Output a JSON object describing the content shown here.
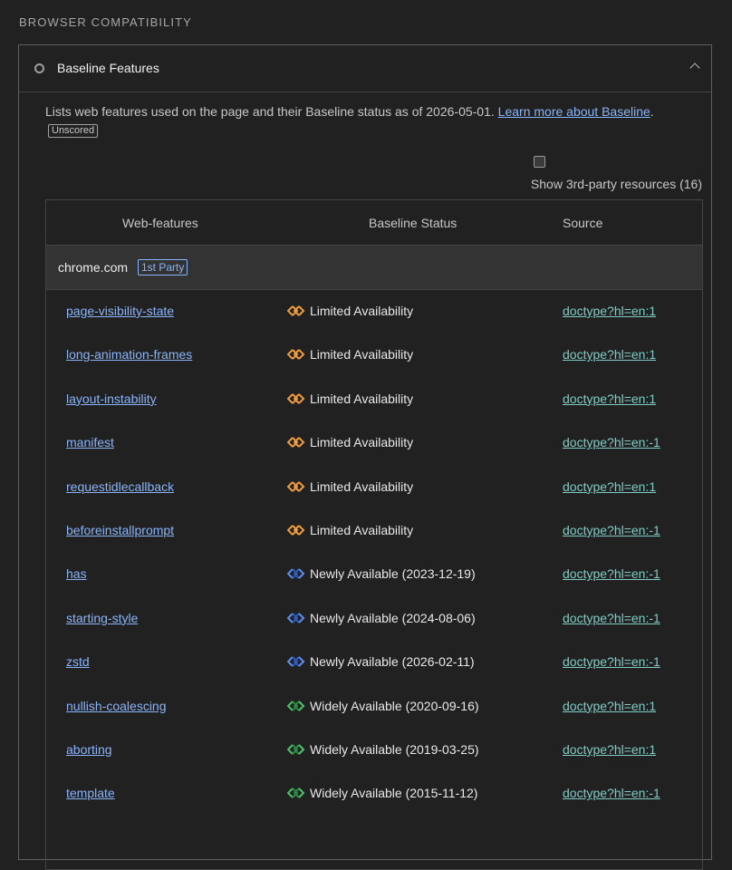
{
  "section_header": "BROWSER COMPATIBILITY",
  "card": {
    "title": "Baseline Features",
    "description": "Lists web features used on the page and their Baseline status as of 2026-05-01. ",
    "learn_more": "Learn more about Baseline",
    "description_end": ".",
    "badge": "Unscored"
  },
  "third_party": {
    "label": "Show 3rd-party resources (16)"
  },
  "table": {
    "headers": {
      "feature": "Web-features",
      "status": "Baseline Status",
      "source": "Source"
    },
    "group": {
      "name": "chrome.com",
      "badge": "1st Party"
    },
    "rows": [
      {
        "feature": "page-visibility-state",
        "status": "Limited Availability",
        "kind": "limited",
        "source": "doctype?hl=en:1"
      },
      {
        "feature": "long-animation-frames",
        "status": "Limited Availability",
        "kind": "limited",
        "source": "doctype?hl=en:1"
      },
      {
        "feature": "layout-instability",
        "status": "Limited Availability",
        "kind": "limited",
        "source": "doctype?hl=en:1"
      },
      {
        "feature": "manifest",
        "status": "Limited Availability",
        "kind": "limited",
        "source": "doctype?hl=en:-1"
      },
      {
        "feature": "requestidlecallback",
        "status": "Limited Availability",
        "kind": "limited",
        "source": "doctype?hl=en:1"
      },
      {
        "feature": "beforeinstallprompt",
        "status": "Limited Availability",
        "kind": "limited",
        "source": "doctype?hl=en:-1"
      },
      {
        "feature": "has",
        "status": "Newly Available (2023-12-19)",
        "kind": "newly",
        "source": "doctype?hl=en:-1"
      },
      {
        "feature": "starting-style",
        "status": "Newly Available (2024-08-06)",
        "kind": "newly",
        "source": "doctype?hl=en:-1"
      },
      {
        "feature": "zstd",
        "status": "Newly Available (2026-02-11)",
        "kind": "newly",
        "source": "doctype?hl=en:-1"
      },
      {
        "feature": "nullish-coalescing",
        "status": "Widely Available (2020-09-16)",
        "kind": "widely",
        "source": "doctype?hl=en:1"
      },
      {
        "feature": "aborting",
        "status": "Widely Available (2019-03-25)",
        "kind": "widely",
        "source": "doctype?hl=en:1"
      },
      {
        "feature": "template",
        "status": "Widely Available (2015-11-12)",
        "kind": "widely",
        "source": "doctype?hl=en:-1"
      }
    ]
  },
  "colors": {
    "limited": "#f09c3c",
    "newly": "#5c8ff0",
    "widely": "#4fc36b",
    "link": "#8ab4f8",
    "source_link": "#80cbc4"
  }
}
